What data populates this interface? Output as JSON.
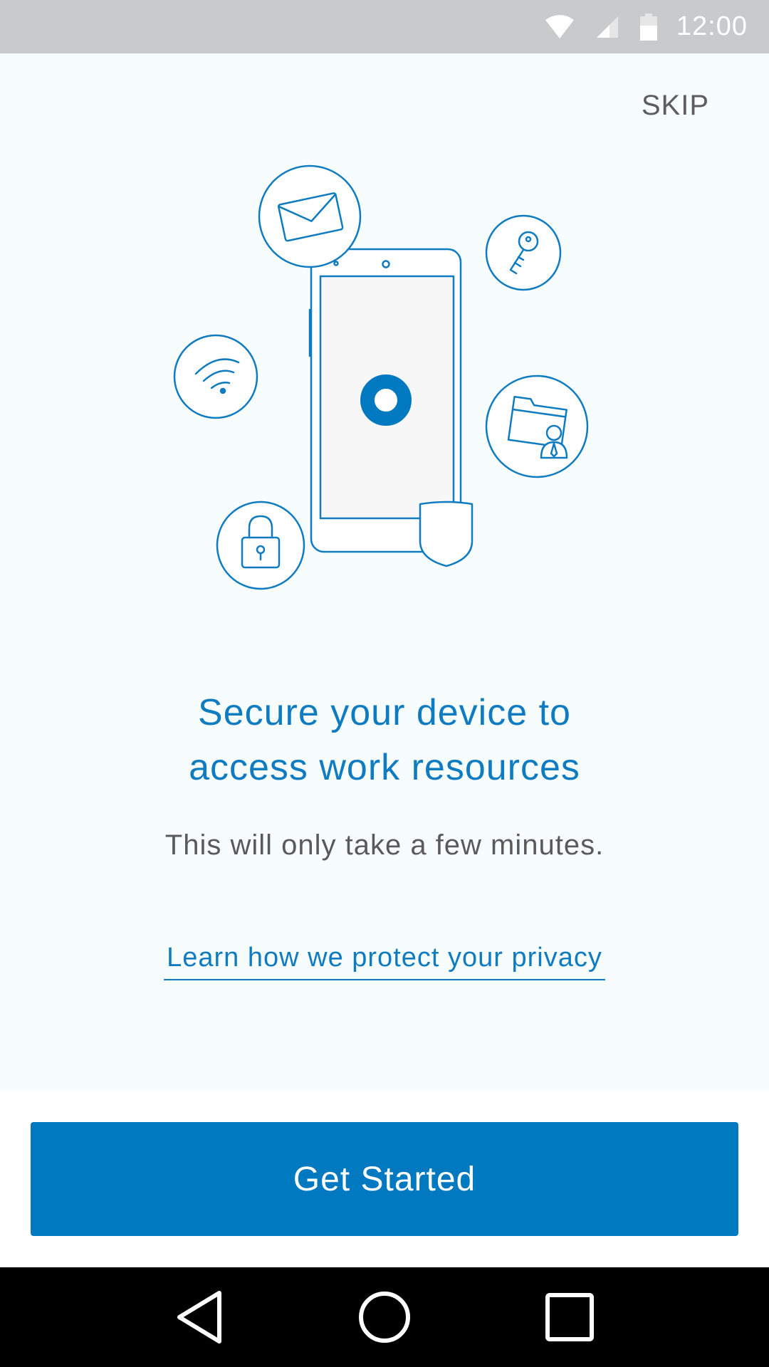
{
  "status_bar": {
    "time": "12:00",
    "icons": [
      "wifi-icon",
      "cell-signal-icon",
      "battery-icon"
    ]
  },
  "header": {
    "skip_label": "SKIP"
  },
  "hero": {
    "icons": [
      "mail-icon",
      "key-icon",
      "wifi-icon",
      "folder-user-icon",
      "lock-icon",
      "shield-icon",
      "phone-icon"
    ]
  },
  "content": {
    "headline_line1": "Secure your device to",
    "headline_line2": "access work resources",
    "subtext": "This will only take a few minutes.",
    "privacy_link": "Learn how we protect your privacy"
  },
  "footer": {
    "primary_button": "Get Started"
  },
  "nav_bar": {
    "buttons": [
      "back-icon",
      "home-icon",
      "recents-icon"
    ]
  },
  "colors": {
    "accent": "#0079c1",
    "link_text": "#0f7bc1",
    "status_bar": "#c8cacb",
    "background": "#f7fcfd"
  }
}
